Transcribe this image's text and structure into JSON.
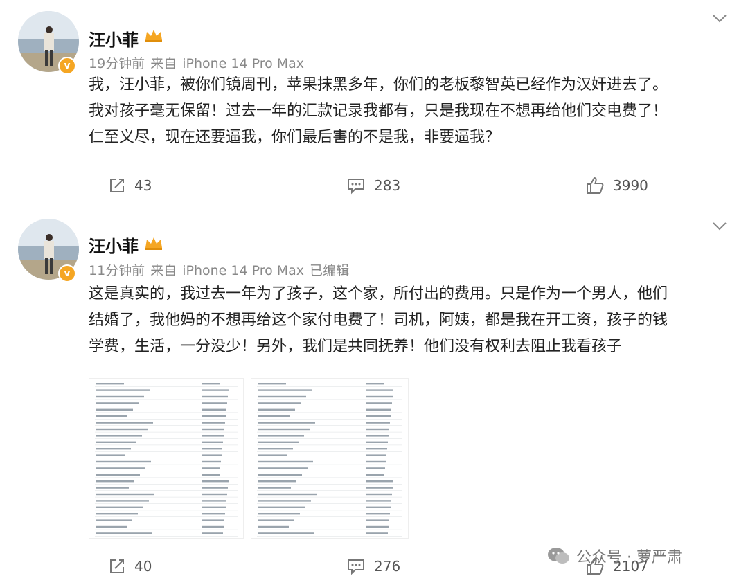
{
  "posts": [
    {
      "author": "汪小菲",
      "time": "19分钟前",
      "source_prefix": "来自",
      "device": "iPhone 14 Pro Max",
      "edited": "",
      "lines": [
        "我，汪小菲，被你们镜周刊，苹果抹黑多年，你们的老板黎智英已经作为汉奸进去了。",
        "我对孩子毫无保留！过去一年的汇款记录我都有，只是我现在不想再给他们交电费了！",
        "仁至义尽，现在还要逼我，你们最后害的不是我，非要逼我？"
      ],
      "reposts": "43",
      "comments": "283",
      "likes": "3990"
    },
    {
      "author": "汪小菲",
      "time": "11分钟前",
      "source_prefix": "来自",
      "device": "iPhone 14 Pro Max",
      "edited": "已编辑",
      "lines": [
        "这是真实的，我过去一年为了孩子，这个家，所付出的费用。只是作为一个男人，他们",
        "结婚了，我他妈的不想再给这个家付电费了！司机，阿姨，都是我在开工资，孩子的钱",
        "学费，生活，一分没少！另外，我们是共同抚养！他们没有权利去阻止我看孩子"
      ],
      "reposts": "40",
      "comments": "276",
      "likes": "2107"
    }
  ],
  "watermark": "公众号 · 萝严肃",
  "colors": {
    "badge": "#f5a623",
    "meta": "#888888",
    "action": "#555555"
  },
  "icons": [
    "crown-icon",
    "verified-badge-icon",
    "chevron-down-icon",
    "repost-icon",
    "comment-icon",
    "like-icon",
    "wechat-icon"
  ]
}
